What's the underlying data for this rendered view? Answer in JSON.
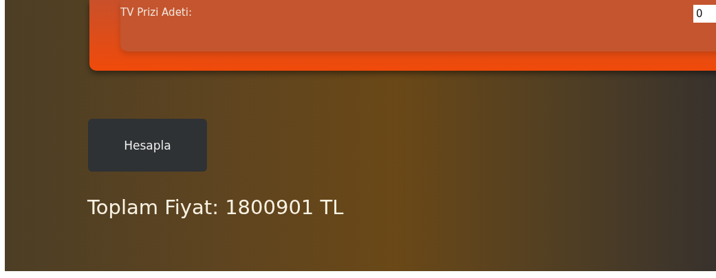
{
  "form": {
    "fields": [
      {
        "label": "TV Prizi Adeti:",
        "value": "0"
      }
    ]
  },
  "button": {
    "label": "Hesapla"
  },
  "result": {
    "text": "Toplam Fiyat: 1800901 TL"
  }
}
